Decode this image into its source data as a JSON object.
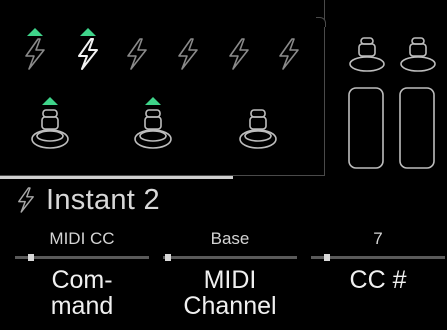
{
  "instants": [
    {
      "id": 1,
      "active": true,
      "selected": false
    },
    {
      "id": 2,
      "active": true,
      "selected": true
    },
    {
      "id": 3,
      "active": false,
      "selected": false
    },
    {
      "id": 4,
      "active": false,
      "selected": false
    },
    {
      "id": 5,
      "active": false,
      "selected": false
    },
    {
      "id": 6,
      "active": false,
      "selected": false
    }
  ],
  "footswitches": [
    {
      "id": 1,
      "active": true
    },
    {
      "id": 2,
      "active": true
    },
    {
      "id": 3,
      "active": false
    }
  ],
  "expression_pedals": [
    {
      "id": 1
    },
    {
      "id": 2
    }
  ],
  "icons": {
    "instant": "lightning-bolt-icon",
    "footswitch": "footswitch-icon",
    "pedal": "expression-pedal-icon"
  },
  "colors": {
    "active_indicator": "#3fd48a",
    "background": "#000000",
    "text": "#e8e8e8"
  },
  "header": {
    "title": "Instant 2"
  },
  "params": [
    {
      "value": "MIDI CC",
      "label_line1": "Com-",
      "label_line2": "mand",
      "position": 0.1
    },
    {
      "value": "Base",
      "label_line1": "MIDI",
      "label_line2": "Channel",
      "position": 0.0
    },
    {
      "value": "7",
      "label_line1": "CC #",
      "label_line2": "",
      "position": 0.1
    }
  ]
}
